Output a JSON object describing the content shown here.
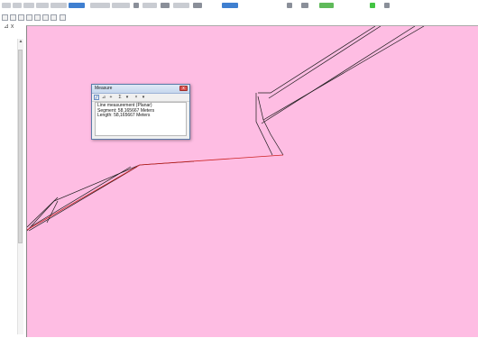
{
  "toolbar": {
    "row1_buttons": [
      "zoom-in",
      "zoom-out",
      "pan",
      "full-extent",
      "back-extent",
      "forward-extent",
      "select",
      "identify",
      "find",
      "measure",
      "hyperlink",
      "html-popup",
      "goto-xy",
      "time-slider",
      "create-viewer",
      "editor",
      "sketch-tool",
      "add-data"
    ],
    "row2_buttons": [
      "rotate",
      "undo",
      "redo",
      "cut",
      "copy",
      "paste",
      "delete"
    ]
  },
  "left_panel": {
    "close_label": "x"
  },
  "map": {
    "background": "#febde3",
    "line_color": "#1a1a1a",
    "measure_line_color": "#cc2222"
  },
  "measure_window": {
    "title": "Measure",
    "close_glyph": "x",
    "tools": [
      "measure-line-icon",
      "measure-area-icon",
      "measure-feature-icon",
      "sum-icon",
      "units-dropdown-icon",
      "clear-icon",
      "options-dropdown-icon"
    ],
    "lines": [
      "Line measurement (Planar)",
      "Segment: 58,165667 Meters",
      "Length: 58,165667 Meters"
    ]
  }
}
